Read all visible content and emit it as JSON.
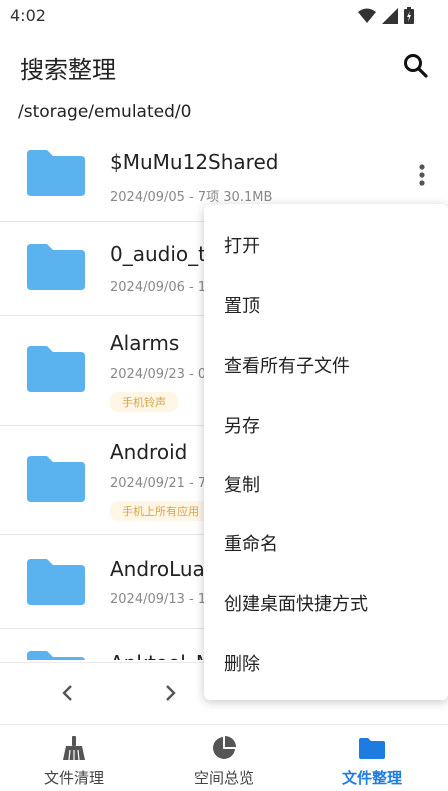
{
  "status": {
    "time": "4:02"
  },
  "app": {
    "title": "搜索整理",
    "search_icon": "search-icon"
  },
  "path": "/storage/emulated/0",
  "files": [
    {
      "name": "$MuMu12Shared",
      "meta": "2024/09/05 - 7项 30.1MB",
      "tag": null
    },
    {
      "name": "0_audio_t",
      "meta": "2024/09/06 - 1",
      "tag": null
    },
    {
      "name": "Alarms",
      "meta": "2024/09/23 - 0",
      "tag": "手机铃声"
    },
    {
      "name": "Android",
      "meta": "2024/09/21 - 7",
      "tag": "手机上所有应用"
    },
    {
      "name": "AndroLua",
      "meta": "2024/09/13 - 1",
      "tag": null
    },
    {
      "name": "Apktool_M",
      "meta": "",
      "tag": null
    }
  ],
  "context_menu": {
    "items": [
      "打开",
      "置顶",
      "查看所有子文件",
      "另存",
      "复制",
      "重命名",
      "创建桌面快捷方式",
      "删除"
    ]
  },
  "bottom_nav": [
    {
      "label": "文件清理",
      "icon": "broom-icon",
      "active": false
    },
    {
      "label": "空间总览",
      "icon": "pie-chart-icon",
      "active": false
    },
    {
      "label": "文件整理",
      "icon": "folder-icon",
      "active": true
    }
  ],
  "colors": {
    "accent": "#1e7be0",
    "folder": "#5ab3ef",
    "tag_text": "#d8a44a",
    "tag_bg": "#fff6e6"
  }
}
